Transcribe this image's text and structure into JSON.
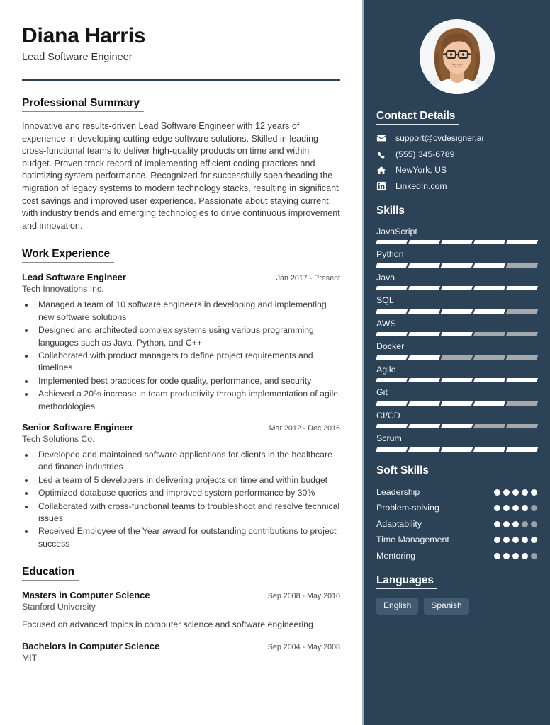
{
  "header": {
    "name": "Diana Harris",
    "job_title": "Lead Software Engineer"
  },
  "sections": {
    "professional_summary_heading": "Professional Summary",
    "work_experience_heading": "Work Experience",
    "education_heading": "Education",
    "contact_heading": "Contact Details",
    "skills_heading": "Skills",
    "soft_skills_heading": "Soft Skills",
    "languages_heading": "Languages"
  },
  "summary": "Innovative and results-driven Lead Software Engineer with 12 years of experience in developing cutting-edge software solutions. Skilled in leading cross-functional teams to deliver high-quality products on time and within budget. Proven track record of implementing efficient coding practices and optimizing system performance. Recognized for successfully spearheading the migration of legacy systems to modern technology stacks, resulting in significant cost savings and improved user experience. Passionate about staying current with industry trends and emerging technologies to drive continuous improvement and innovation.",
  "work_experience": [
    {
      "title": "Lead Software Engineer",
      "company": "Tech Innovations Inc.",
      "dates": "Jan 2017 - Present",
      "bullets": [
        "Managed a team of 10 software engineers in developing and implementing new software solutions",
        "Designed and architected complex systems using various programming languages such as Java, Python, and C++",
        "Collaborated with product managers to define project requirements and timelines",
        "Implemented best practices for code quality, performance, and security",
        "Achieved a 20% increase in team productivity through implementation of agile methodologies"
      ]
    },
    {
      "title": "Senior Software Engineer",
      "company": "Tech Solutions Co.",
      "dates": "Mar 2012 - Dec 2016",
      "bullets": [
        "Developed and maintained software applications for clients in the healthcare and finance industries",
        "Led a team of 5 developers in delivering projects on time and within budget",
        "Optimized database queries and improved system performance by 30%",
        "Collaborated with cross-functional teams to troubleshoot and resolve technical issues",
        "Received Employee of the Year award for outstanding contributions to project success"
      ]
    }
  ],
  "education": [
    {
      "degree": "Masters in Computer Science",
      "school": "Stanford University",
      "dates": "Sep 2008 - May 2010",
      "description": "Focused on advanced topics in computer science and software engineering"
    },
    {
      "degree": "Bachelors in Computer Science",
      "school": "MIT",
      "dates": "Sep 2004 - May 2008",
      "description": ""
    }
  ],
  "contact": [
    {
      "icon": "envelope-icon",
      "value": "support@cvdesigner.ai"
    },
    {
      "icon": "phone-icon",
      "value": "(555) 345-6789"
    },
    {
      "icon": "home-icon",
      "value": "NewYork, US"
    },
    {
      "icon": "linkedin-icon",
      "value": "LinkedIn.com"
    }
  ],
  "skills": [
    {
      "name": "JavaScript",
      "level": 5,
      "max": 5
    },
    {
      "name": "Python",
      "level": 4,
      "max": 5
    },
    {
      "name": "Java",
      "level": 5,
      "max": 5
    },
    {
      "name": "SQL",
      "level": 4,
      "max": 5
    },
    {
      "name": "AWS",
      "level": 3,
      "max": 5
    },
    {
      "name": "Docker",
      "level": 2,
      "max": 5
    },
    {
      "name": "Agile",
      "level": 5,
      "max": 5
    },
    {
      "name": "Git",
      "level": 4,
      "max": 5
    },
    {
      "name": "CI/CD",
      "level": 3,
      "max": 5
    },
    {
      "name": "Scrum",
      "level": 5,
      "max": 5
    }
  ],
  "soft_skills": [
    {
      "name": "Leadership",
      "level": 5,
      "max": 5
    },
    {
      "name": "Problem-solving",
      "level": 4,
      "max": 5
    },
    {
      "name": "Adaptability",
      "level": 3,
      "max": 5
    },
    {
      "name": "Time Management",
      "level": 5,
      "max": 5
    },
    {
      "name": "Mentoring",
      "level": 4,
      "max": 5
    }
  ],
  "languages": [
    "English",
    "Spanish"
  ],
  "colors": {
    "sidebar_bg": "#2b4257",
    "rule": "#2f4257",
    "divider": "#9fb0c0",
    "bar_on": "#ffffff",
    "bar_off": "#a3aaaf",
    "chip_bg": "#415a72"
  }
}
